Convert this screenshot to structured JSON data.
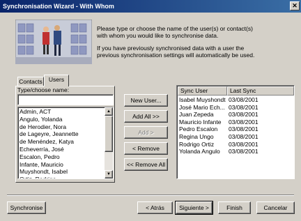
{
  "window": {
    "title": "Synchronisation Wizard - With Whom",
    "close_glyph": "✕"
  },
  "intro": {
    "line1": "Please type or choose the name of the user(s) or contact(s)",
    "line2": "with whom you would like to synchronise data.",
    "line3": "If you have previously synchronised data with a user the",
    "line4": "previous synchronisation settings will automatically be used."
  },
  "tabs": [
    {
      "label": "Contacts"
    },
    {
      "label": "Users"
    }
  ],
  "user_panel": {
    "field_label": "Type/choose name:",
    "input_value": "",
    "names": [
      "Admin, ACT",
      "Angulo, Yolanda",
      "de Herodier, Nora",
      "de Lageyre, Jeannette",
      "de Menéndez, Katya",
      "Echeverría, José",
      "Escalon, Pedro",
      "Infante, Mauricio",
      "Muyshondt, Isabel",
      "Ortiz, Rodrigo"
    ]
  },
  "middle_buttons": {
    "new_user": "New User...",
    "add_all": "Add All >>",
    "add": "Add >",
    "remove": "< Remove",
    "remove_all": "<< Remove All"
  },
  "sync_table": {
    "columns": [
      "Sync User",
      "Last Sync"
    ],
    "rows": [
      [
        "Isabel Muyshondt",
        "03/08/2001"
      ],
      [
        "José Mario Ech...",
        "03/08/2001"
      ],
      [
        "Juan Zepeda",
        "03/08/2001"
      ],
      [
        "Mauricio Infante",
        "03/08/2001"
      ],
      [
        "Pedro Escalon",
        "03/08/2001"
      ],
      [
        "Regina Ungo",
        "03/08/2001"
      ],
      [
        "Rodrigo Ortiz",
        "03/08/2001"
      ],
      [
        "Yolanda Angulo",
        "03/08/2001"
      ]
    ]
  },
  "footer": {
    "synchronise": "Synchronise",
    "back": "< Atrás",
    "next": "Siguiente >",
    "finish": "Finish",
    "cancel": "Cancelar"
  },
  "colors": {
    "title_start": "#0a246a",
    "title_end": "#3a6ea5",
    "face": "#d4d0c8"
  },
  "scrollbar": {
    "up_glyph": "▲",
    "down_glyph": "▼"
  }
}
